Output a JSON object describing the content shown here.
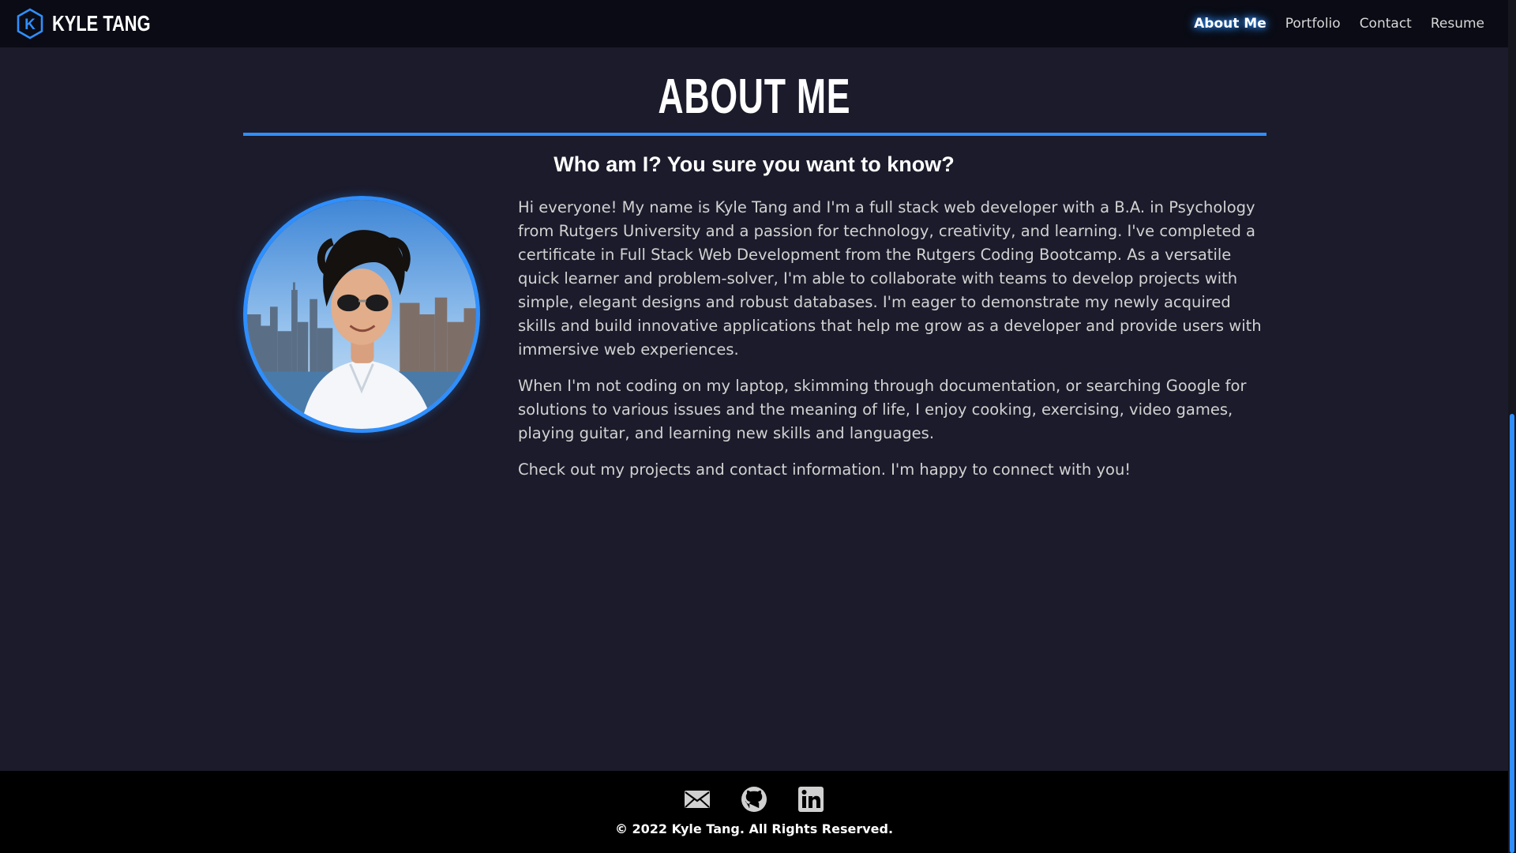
{
  "nav": {
    "brand_name": "KYLE TANG",
    "brand_logo_letter": "K",
    "links": [
      {
        "label": "About Me",
        "active": true
      },
      {
        "label": "Portfolio",
        "active": false
      },
      {
        "label": "Contact",
        "active": false
      },
      {
        "label": "Resume",
        "active": false
      }
    ]
  },
  "main": {
    "title": "ABOUT ME",
    "subtitle": "Who am I? You sure you want to know?",
    "paragraphs": [
      "Hi everyone! My name is Kyle Tang and I'm a full stack web developer with a B.A. in Psychology from Rutgers University and a passion for technology, creativity, and learning. I've completed a certificate in Full Stack Web Development from the Rutgers Coding Bootcamp. As a versatile quick learner and problem-solver, I'm able to collaborate with teams to develop projects with simple, elegant designs and robust databases. I'm eager to demonstrate my newly acquired skills and build innovative applications that help me grow as a developer and provide users with immersive web experiences.",
      "When I'm not coding on my laptop, skimming through documentation, or searching Google for solutions to various issues and the meaning of life, I enjoy cooking, exercising, video games, playing guitar, and learning new skills and languages.",
      "Check out my projects and contact information. I'm happy to connect with you!"
    ]
  },
  "footer": {
    "icons": [
      "email-icon",
      "github-icon",
      "linkedin-icon"
    ],
    "copyright": "© 2022 Kyle Tang. All Rights Reserved."
  },
  "colors": {
    "accent": "#2f8fff",
    "background": "#1b1b2b",
    "navbar": "#0a0b14",
    "footer": "#000000"
  }
}
